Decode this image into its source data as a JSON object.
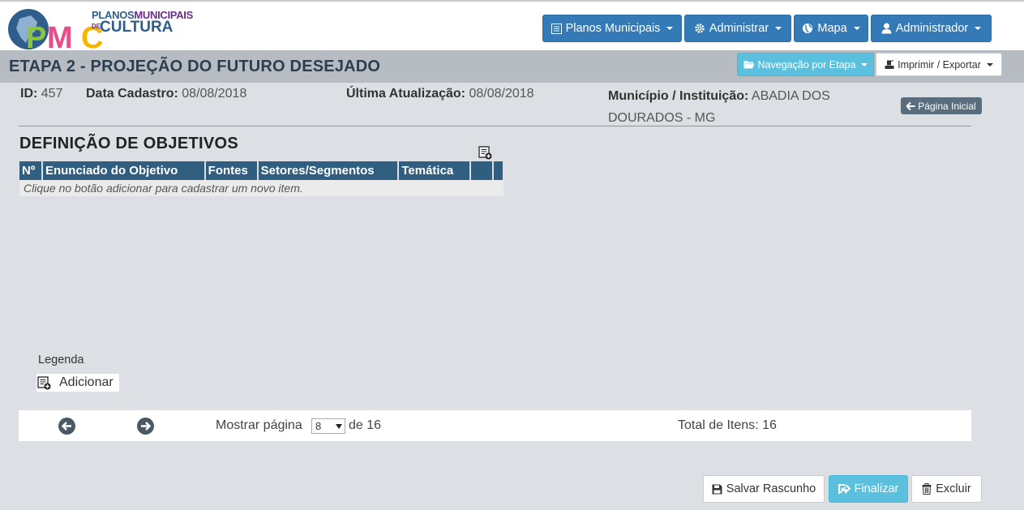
{
  "header": {
    "logo": {
      "top_line_1": "PLANOS",
      "top_line_2": "MUNICIPAIS",
      "de": "DE",
      "bottom": "CULTURA",
      "mark": "PMC"
    },
    "nav": [
      {
        "label": "Planos Municipais",
        "icon": "list-icon"
      },
      {
        "label": "Administrar",
        "icon": "gear-icon"
      },
      {
        "label": "Mapa",
        "icon": "globe-icon"
      },
      {
        "label": "Administrador",
        "icon": "user-icon"
      }
    ]
  },
  "titlebar": {
    "title": "ETAPA 2 - PROJEÇÃO DO FUTURO DESEJADO",
    "nav_etapa_label": "Navegação por Etapa",
    "imprimir_label": "Imprimir / Exportar"
  },
  "info": {
    "id_label": "ID:",
    "id_value": "457",
    "cadastro_label": "Data Cadastro:",
    "cadastro_value": "08/08/2018",
    "atualizacao_label": "Última Atualização:",
    "atualizacao_value": "08/08/2018",
    "municipio_label": "Município / Instituição:",
    "municipio_value": "ABADIA DOS DOURADOS - MG",
    "pagina_inicial_label": "Página Inicial"
  },
  "section": {
    "title": "DEFINIÇÃO DE OBJETIVOS",
    "columns": [
      "Nº",
      "Enunciado do Objetivo",
      "Fontes",
      "Setores/Segmentos",
      "Temática",
      "",
      ""
    ],
    "empty_message": "Clique no botão adicionar para cadastrar um novo item."
  },
  "legend": {
    "title": "Legenda",
    "add_label": "Adicionar"
  },
  "pager": {
    "show_page_label": "Mostrar página",
    "current_page": "8",
    "of_label": "de 16",
    "total_label": "Total de Itens: 16"
  },
  "actions": {
    "salvar_label": "Salvar Rascunho",
    "finalizar_label": "Finalizar",
    "excluir_label": "Excluir"
  },
  "colors": {
    "primary": "#337ab7",
    "info": "#5bc0de",
    "table_header": "#2f5e80",
    "title_bar": "#b7bcc2",
    "background": "#dcdfe3"
  }
}
